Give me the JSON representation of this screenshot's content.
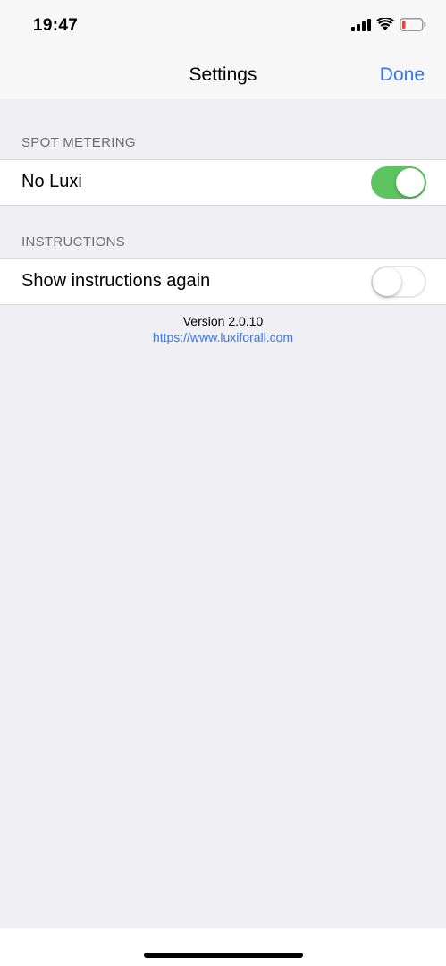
{
  "status_bar": {
    "time": "19:47",
    "icons": [
      "cellular-signal-icon",
      "wifi-icon",
      "battery-low-icon"
    ],
    "battery_color": "#e8423b"
  },
  "nav": {
    "title": "Settings",
    "done_label": "Done",
    "accent_color": "#3478f6"
  },
  "sections": [
    {
      "header": "SPOT METERING",
      "rows": [
        {
          "label": "No Luxi",
          "toggle_on": true
        }
      ]
    },
    {
      "header": "INSTRUCTIONS",
      "rows": [
        {
          "label": "Show instructions again",
          "toggle_on": false
        }
      ]
    }
  ],
  "footer": {
    "version": "Version 2.0.10",
    "link": "https://www.luxiforall.com"
  }
}
